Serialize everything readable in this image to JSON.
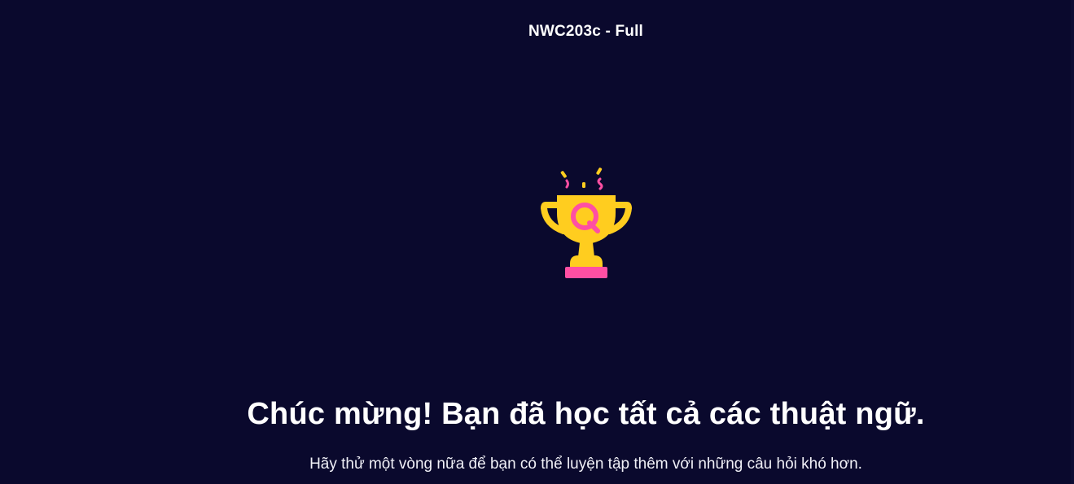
{
  "header": {
    "set_title": "NWC203c - Full"
  },
  "completion": {
    "icon": "trophy-icon",
    "heading": "Chúc mừng! Bạn đã học tất cả các thuật ngữ.",
    "subtext": "Hãy thử một vòng nữa để bạn có thể luyện tập thêm với những câu hỏi khó hơn."
  },
  "colors": {
    "background": "#0a092d",
    "trophy_gold": "#ffcd1f",
    "trophy_pink": "#ff4fa3",
    "text": "#ffffff"
  }
}
